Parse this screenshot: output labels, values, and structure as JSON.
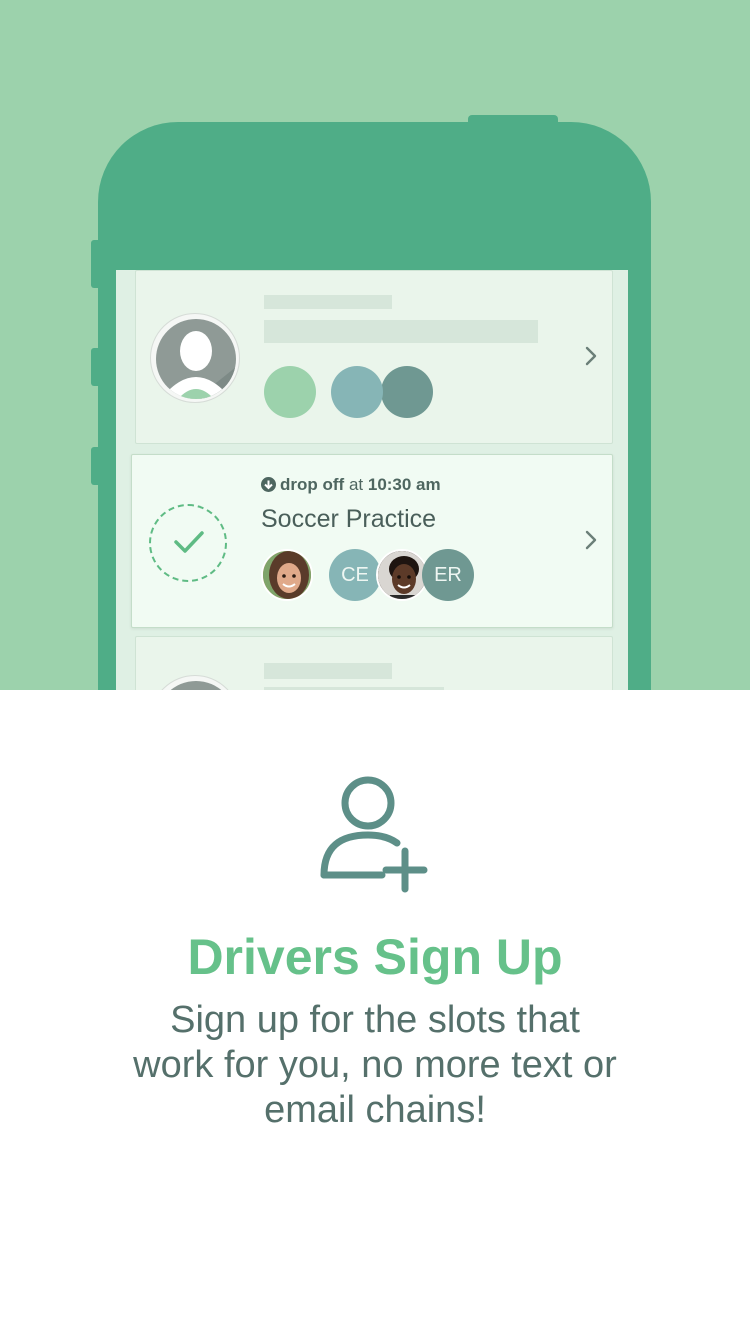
{
  "colors": {
    "hero_bg": "#9cd2ac",
    "phone": "#4fad87",
    "accent": "#66c18a",
    "text": "#55706b"
  },
  "card_active": {
    "meta_icon": "download-arrow-icon",
    "meta_type": "drop off",
    "meta_at": "at",
    "meta_time": "10:30 am",
    "title": "Soccer Practice",
    "participants": [
      {
        "type": "photo",
        "name": "girl-photo-avatar"
      },
      {
        "type": "initials",
        "text": "CE"
      },
      {
        "type": "photo",
        "name": "boy-photo-avatar"
      },
      {
        "type": "initials",
        "text": "ER"
      }
    ]
  },
  "icons": {
    "chevron": "chevron-right-icon",
    "check": "check-icon",
    "add_user": "add-user-icon"
  },
  "onboarding": {
    "heading": "Drivers Sign Up",
    "body": "Sign up for the slots that work for you, no more text or email chains!"
  }
}
